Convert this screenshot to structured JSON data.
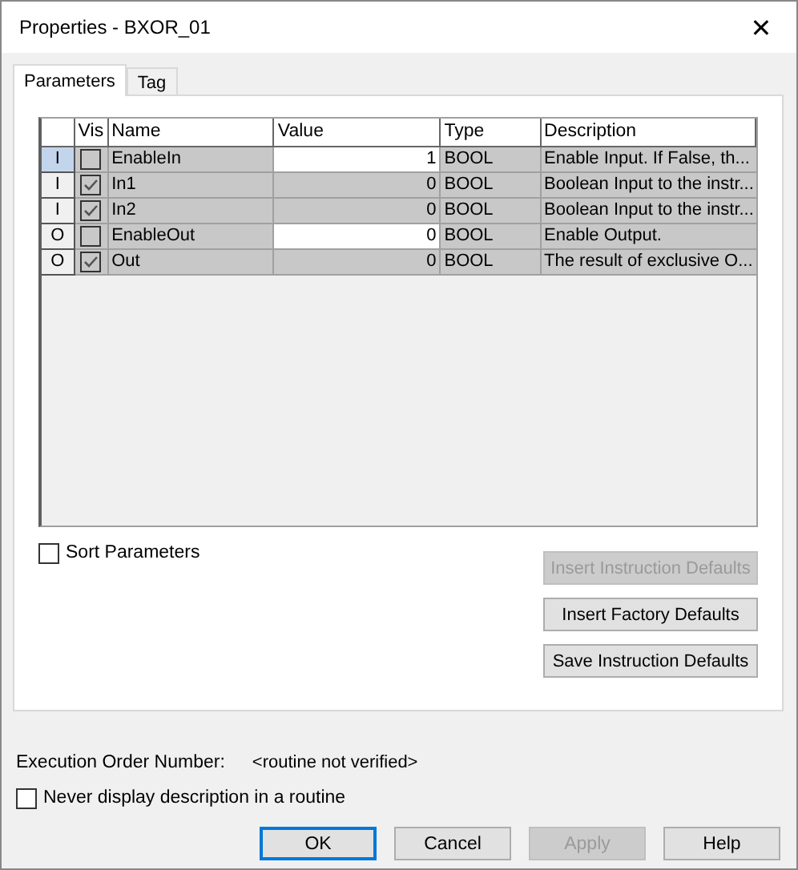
{
  "window": {
    "title": "Properties - BXOR_01",
    "close": "✕"
  },
  "tabs": [
    {
      "label": "Parameters",
      "selected": true
    },
    {
      "label": "Tag",
      "selected": false
    }
  ],
  "table": {
    "columns": [
      "Vis",
      "Name",
      "Value",
      "Type",
      "Description"
    ],
    "rows": [
      {
        "usage": "I",
        "selected": true,
        "vis": false,
        "name": "EnableIn",
        "value": "1",
        "editable": true,
        "type": "BOOL",
        "description": "Enable Input.  If False, th..."
      },
      {
        "usage": "I",
        "selected": false,
        "vis": true,
        "name": "In1",
        "value": "0",
        "editable": false,
        "type": "BOOL",
        "description": "Boolean Input to the instr..."
      },
      {
        "usage": "I",
        "selected": false,
        "vis": true,
        "name": "In2",
        "value": "0",
        "editable": false,
        "type": "BOOL",
        "description": "Boolean Input to the instr..."
      },
      {
        "usage": "O",
        "selected": false,
        "vis": false,
        "name": "EnableOut",
        "value": "0",
        "editable": true,
        "type": "BOOL",
        "description": "Enable Output."
      },
      {
        "usage": "O",
        "selected": false,
        "vis": true,
        "name": "Out",
        "value": "0",
        "editable": false,
        "type": "BOOL",
        "description": "The result of exclusive O..."
      }
    ]
  },
  "sort_parameters": {
    "label": "Sort Parameters",
    "checked": false
  },
  "side_buttons": [
    {
      "label": "Insert Instruction Defaults",
      "disabled": true
    },
    {
      "label": "Insert Factory Defaults",
      "disabled": false
    },
    {
      "label": "Save Instruction Defaults",
      "disabled": false
    }
  ],
  "execution_order": {
    "label": "Execution Order Number:",
    "value": "<routine not verified>"
  },
  "never_display": {
    "label": "Never display description in a routine",
    "checked": false
  },
  "buttons": [
    {
      "label": "OK",
      "disabled": false,
      "default": true
    },
    {
      "label": "Cancel",
      "disabled": false,
      "default": false
    },
    {
      "label": "Apply",
      "disabled": true,
      "default": false
    },
    {
      "label": "Help",
      "disabled": false,
      "default": false
    }
  ]
}
